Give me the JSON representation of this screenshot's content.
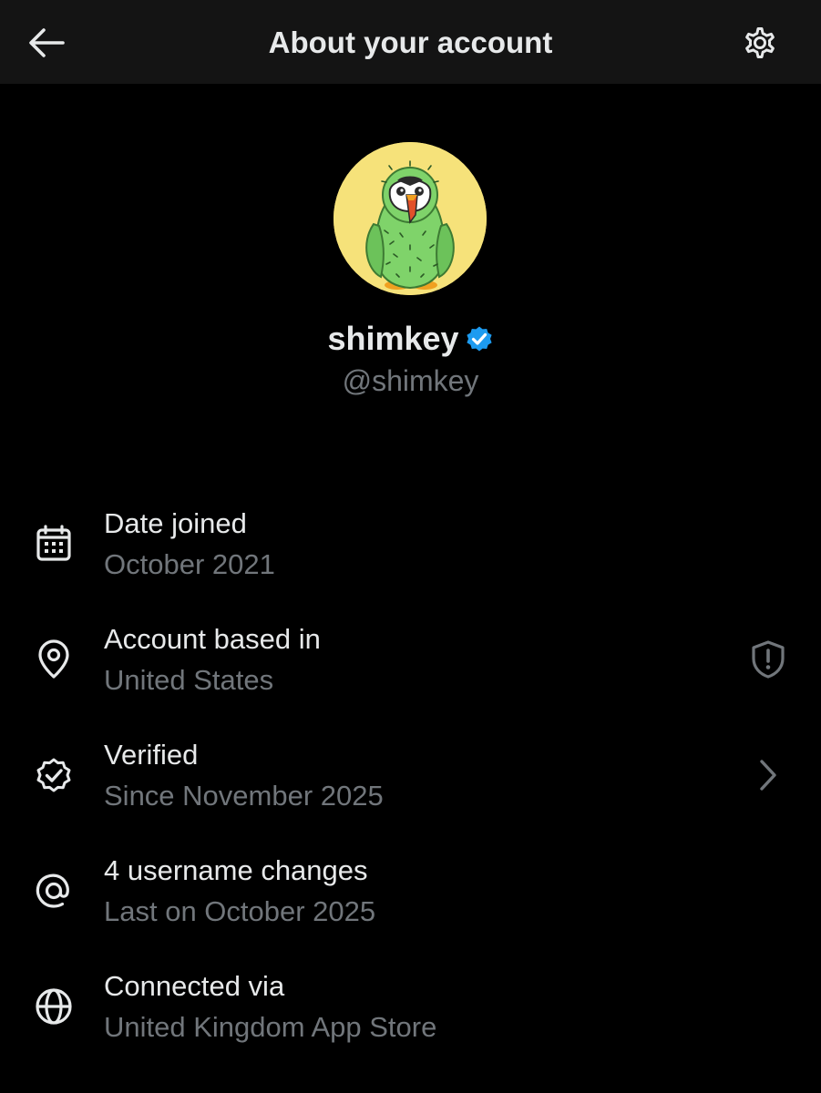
{
  "header": {
    "title": "About your account",
    "back_icon": "arrow-left-icon",
    "settings_icon": "gear-icon"
  },
  "profile": {
    "display_name": "shimkey",
    "handle": "@shimkey",
    "verified_badge_icon": "verified-badge-icon",
    "avatar": "puffin-cactus-avatar",
    "colors": {
      "avatar_bg": "#f6e27a",
      "badge": "#1d9bf0"
    }
  },
  "details": [
    {
      "icon": "calendar-icon",
      "label": "Date joined",
      "value": "October 2021"
    },
    {
      "icon": "location-pin-icon",
      "label": "Account based in",
      "value": "United States",
      "trailing_icon": "shield-alert-icon"
    },
    {
      "icon": "verified-check-icon",
      "label": "Verified",
      "value": "Since November 2025",
      "trailing_icon": "chevron-right-icon"
    },
    {
      "icon": "at-sign-icon",
      "label": "4 username changes",
      "value": "Last on October 2025"
    },
    {
      "icon": "globe-icon",
      "label": "Connected via",
      "value": "United Kingdom App Store"
    }
  ],
  "colors": {
    "background": "#000000",
    "header_bg": "#141414",
    "primary_text": "#e7e9ea",
    "secondary_text": "#71767b"
  }
}
